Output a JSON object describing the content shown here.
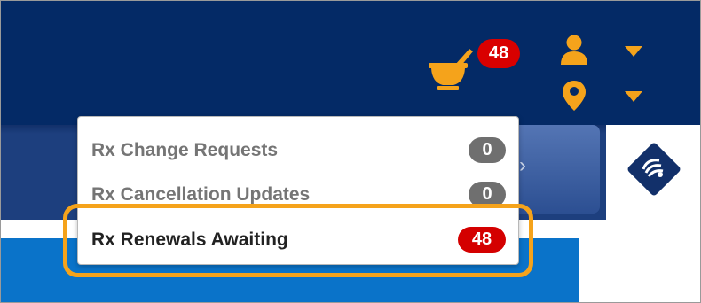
{
  "header": {
    "notification_count": "48",
    "colors": {
      "navy": "#042a66",
      "accent": "#f5a31b",
      "badge_red": "#d90000"
    },
    "icons": [
      "mortar-pestle-icon",
      "user-icon",
      "location-pin-icon",
      "caret-down-icon"
    ]
  },
  "nav": {
    "arrow_glyph": "›"
  },
  "dropdown": {
    "items": [
      {
        "label": "Rx Change Requests",
        "count": "0"
      },
      {
        "label": "Rx Cancellation Updates",
        "count": "0"
      },
      {
        "label": "Rx Renewals Awaiting",
        "count": "48",
        "highlighted": true
      }
    ]
  }
}
